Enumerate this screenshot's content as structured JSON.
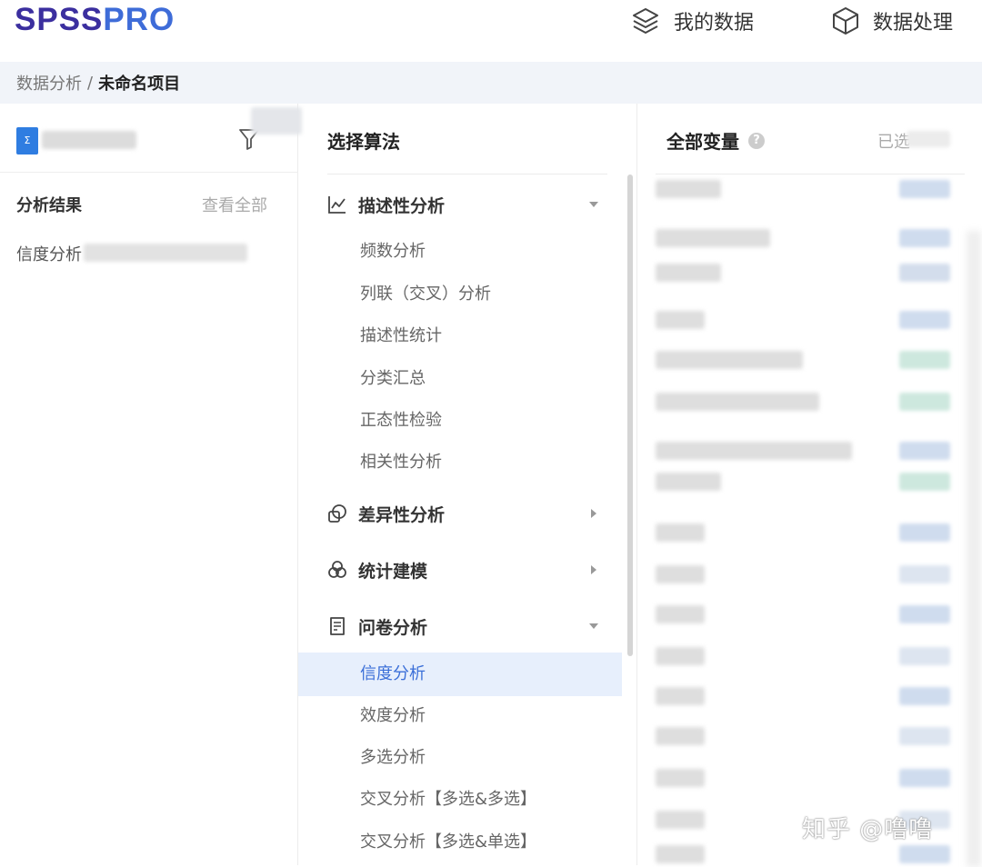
{
  "header": {
    "logo_main": "SPSS",
    "logo_accent": "PRO",
    "nav": [
      {
        "label": "我的数据",
        "icon": "layers-icon"
      },
      {
        "label": "数据处理",
        "icon": "cube-icon"
      }
    ]
  },
  "breadcrumb": {
    "parent": "数据分析",
    "separator": "/",
    "current": "未命名项目"
  },
  "left_panel": {
    "section_title": "分析结果",
    "view_all": "查看全部",
    "results": [
      "信度分析"
    ]
  },
  "algorithms": {
    "title": "选择算法",
    "categories": [
      {
        "label": "描述性分析",
        "icon": "line-chart-icon",
        "expanded": true,
        "items": [
          "频数分析",
          "列联（交叉）分析",
          "描述性统计",
          "分类汇总",
          "正态性检验",
          "相关性分析"
        ]
      },
      {
        "label": "差异性分析",
        "icon": "overlap-icon",
        "expanded": false,
        "items": []
      },
      {
        "label": "统计建模",
        "icon": "venn-icon",
        "expanded": false,
        "items": []
      },
      {
        "label": "问卷分析",
        "icon": "questionnaire-icon",
        "expanded": true,
        "items": [
          "信度分析",
          "效度分析",
          "多选分析",
          "交叉分析【多选&多选】",
          "交叉分析【多选&单选】"
        ],
        "active_item": "信度分析"
      }
    ]
  },
  "variables": {
    "title": "全部变量",
    "help_icon": "?",
    "selected_label": "已选"
  },
  "watermark": "知乎 @噜噜",
  "colors": {
    "logo_dark": "#3b2f9f",
    "logo_light": "#3e6cd8",
    "active": "#3b6fd8",
    "active_bg": "#e7effc",
    "tag_blue": "#cfdcee",
    "tag_green": "#cde8de"
  }
}
